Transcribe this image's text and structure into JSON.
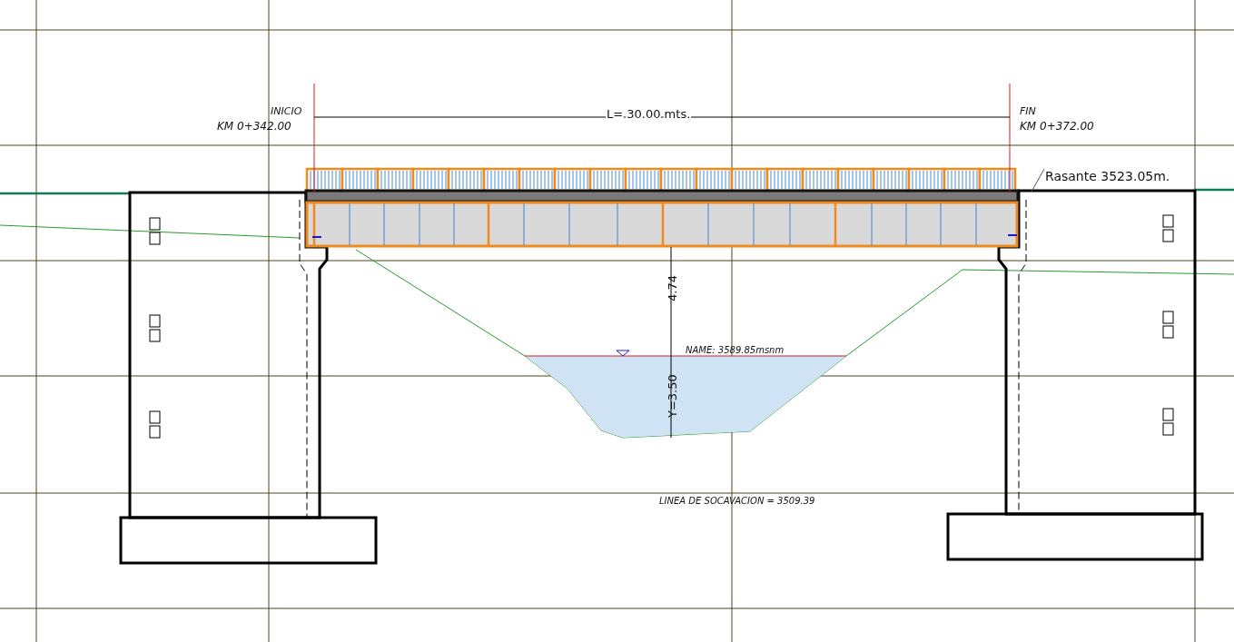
{
  "drawing": {
    "start": {
      "label": "INICIO",
      "station": "KM 0+342.00"
    },
    "end": {
      "label": "FIN",
      "station": "KM 0+372.00"
    },
    "span": "L= 30.00 mts.",
    "grade_level": "Rasante 3523.05m.",
    "clearance": "4.74",
    "water_level": "NAME: 3589.85msnm",
    "water_depth": "Y=3.50",
    "scour_line": "LINEA DE SOCAVACION = 3509.39"
  }
}
